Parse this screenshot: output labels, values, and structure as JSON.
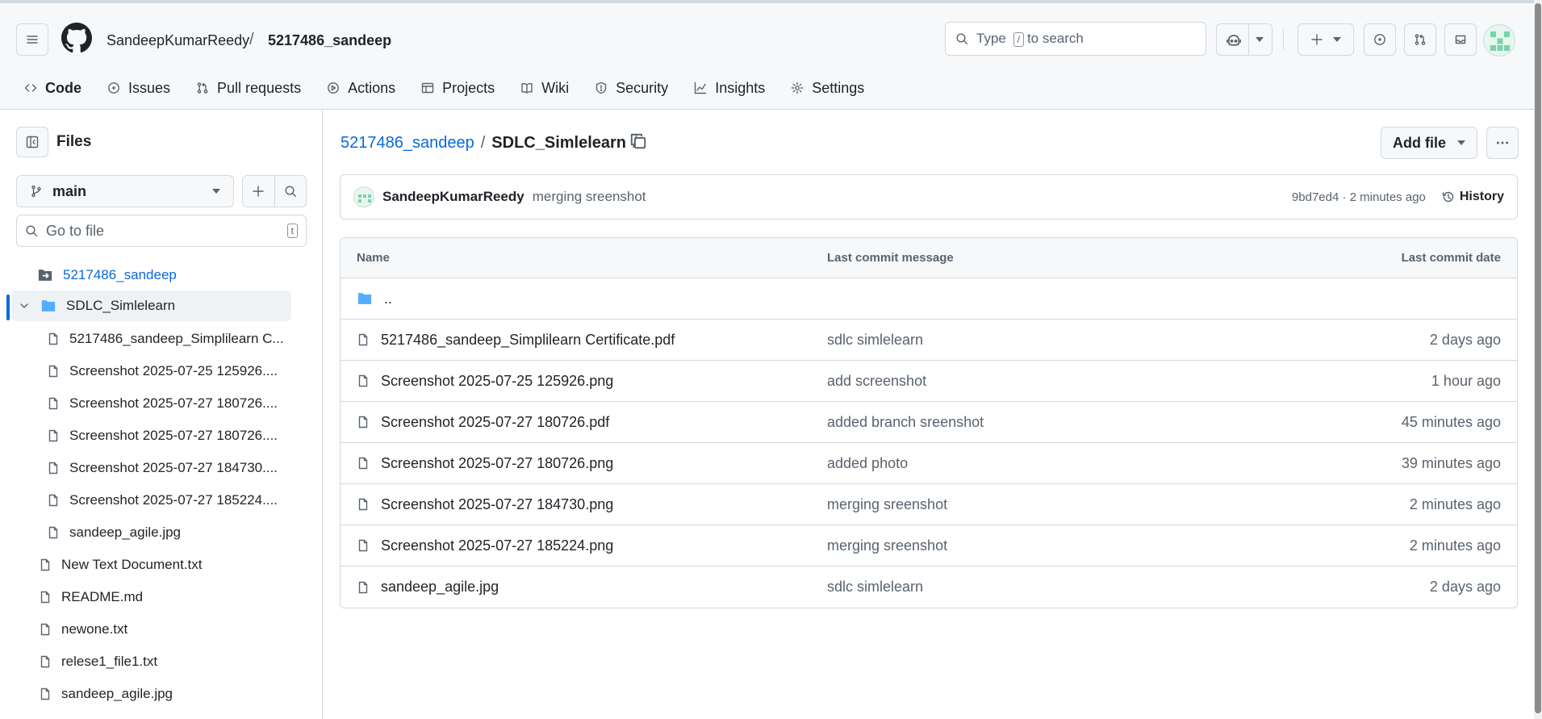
{
  "header": {
    "owner": "SandeepKumarReedy",
    "separator": "/",
    "repo": "5217486_sandeep",
    "search_prefix": "Type",
    "search_key": "/",
    "search_suffix": "to search"
  },
  "tabs": [
    {
      "label": "Code",
      "icon": "code-icon",
      "selected": true
    },
    {
      "label": "Issues",
      "icon": "issue-opened-icon"
    },
    {
      "label": "Pull requests",
      "icon": "git-pull-request-icon"
    },
    {
      "label": "Actions",
      "icon": "play-icon"
    },
    {
      "label": "Projects",
      "icon": "table-icon"
    },
    {
      "label": "Wiki",
      "icon": "book-icon"
    },
    {
      "label": "Security",
      "icon": "shield-icon"
    },
    {
      "label": "Insights",
      "icon": "graph-icon"
    },
    {
      "label": "Settings",
      "icon": "gear-icon"
    }
  ],
  "sidebar": {
    "title": "Files",
    "branch": "main",
    "goto_placeholder": "Go to file",
    "goto_key": "t",
    "tree": [
      {
        "label": "5217486_sandeep",
        "type": "repo-folder"
      },
      {
        "label": "SDLC_Simlelearn",
        "type": "folder-open"
      },
      {
        "label": "5217486_sandeep_Simplilearn C...",
        "type": "file"
      },
      {
        "label": "Screenshot 2025-07-25 125926....",
        "type": "file"
      },
      {
        "label": "Screenshot 2025-07-27 180726....",
        "type": "file"
      },
      {
        "label": "Screenshot 2025-07-27 180726....",
        "type": "file"
      },
      {
        "label": "Screenshot 2025-07-27 184730....",
        "type": "file"
      },
      {
        "label": "Screenshot 2025-07-27 185224....",
        "type": "file"
      },
      {
        "label": "sandeep_agile.jpg",
        "type": "file"
      },
      {
        "label": "New Text Document.txt",
        "type": "file"
      },
      {
        "label": "README.md",
        "type": "file"
      },
      {
        "label": "newone.txt",
        "type": "file"
      },
      {
        "label": "relese1_file1.txt",
        "type": "file"
      },
      {
        "label": "sandeep_agile.jpg",
        "type": "file"
      }
    ]
  },
  "main": {
    "path_root": "5217486_sandeep",
    "path_sep": "/",
    "path_current": "SDLC_Simlelearn",
    "path_trailing": "/",
    "add_file": "Add file",
    "commit": {
      "author": "SandeepKumarReedy",
      "message": "merging sreenshot",
      "meta": "9bd7ed4 · 2 minutes ago",
      "history": "History"
    },
    "table": {
      "headers": {
        "name": "Name",
        "message": "Last commit message",
        "date": "Last commit date"
      },
      "parent": "..",
      "rows": [
        {
          "name": "5217486_sandeep_Simplilearn Certificate.pdf",
          "message": "sdlc simlelearn",
          "date": "2 days ago"
        },
        {
          "name": "Screenshot 2025-07-25 125926.png",
          "message": "add screenshot",
          "date": "1 hour ago"
        },
        {
          "name": "Screenshot 2025-07-27 180726.pdf",
          "message": "added branch sreenshot",
          "date": "45 minutes ago"
        },
        {
          "name": "Screenshot 2025-07-27 180726.png",
          "message": "added photo",
          "date": "39 minutes ago"
        },
        {
          "name": "Screenshot 2025-07-27 184730.png",
          "message": "merging sreenshot",
          "date": "2 minutes ago"
        },
        {
          "name": "Screenshot 2025-07-27 185224.png",
          "message": "merging sreenshot",
          "date": "2 minutes ago"
        },
        {
          "name": "sandeep_agile.jpg",
          "message": "sdlc simlelearn",
          "date": "2 days ago"
        }
      ]
    }
  },
  "colors": {
    "link": "#0969da",
    "folder": "#54aeff",
    "tab_underline": "#fd8c73",
    "border": "#d1d9e0",
    "muted": "#59636e"
  }
}
